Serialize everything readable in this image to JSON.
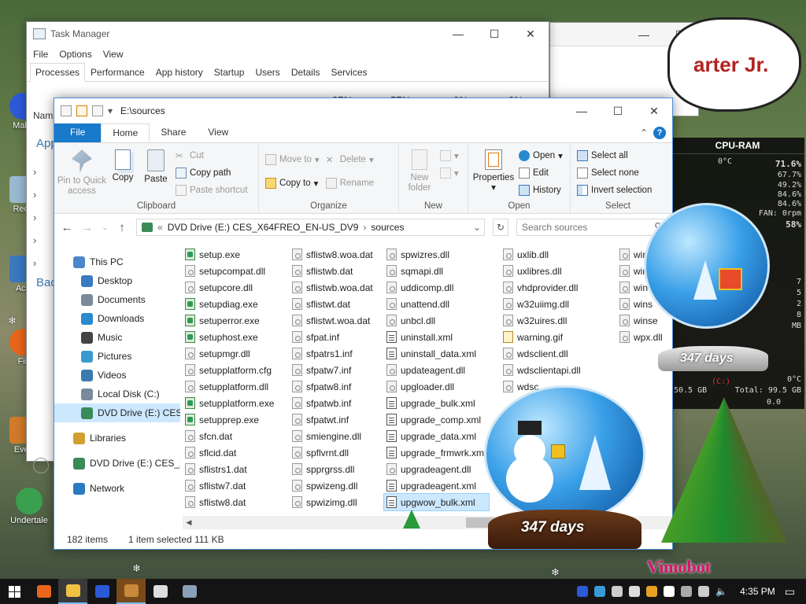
{
  "desktop": {
    "icons": [
      "Malw",
      "Recy",
      "Acti",
      "Fir",
      "Ever",
      "Undertale"
    ],
    "bubble_text": "arter Jr.",
    "watermark": "Vimobot"
  },
  "taskmgr": {
    "title": "Task Manager",
    "menu": [
      "File",
      "Options",
      "View"
    ],
    "tabs": [
      "Processes",
      "Performance",
      "App history",
      "Startup",
      "Users",
      "Details",
      "Services"
    ],
    "cols": [
      "87%",
      "57%",
      "0%",
      "0%"
    ],
    "left_labels": [
      "Nam",
      "App",
      "Bac"
    ]
  },
  "gadget": {
    "title": "CPU-RAM",
    "temp": "0°C",
    "values": [
      "71.6%",
      "67.7%",
      "49.2%",
      "84.6%",
      "84.6%",
      "FAN: 0rpm",
      "58%"
    ],
    "right_values": [
      "7",
      "5",
      "2",
      "8",
      "3",
      "MB",
      "2 MB"
    ],
    "drive_label": "(C:)",
    "drive_temp": "0°C",
    "used": "50.5 GB",
    "total": "Total: 99.5 GB",
    "zeros": [
      "0.0",
      "0.0"
    ]
  },
  "globes": {
    "small_days": "347 days",
    "large_days": "347 days"
  },
  "explorer": {
    "title_path": "E:\\sources",
    "tabs": {
      "file": "File",
      "home": "Home",
      "share": "Share",
      "view": "View"
    },
    "ribbon": {
      "clipboard": {
        "pin": "Pin to Quick access",
        "copy": "Copy",
        "paste": "Paste",
        "cut": "Cut",
        "copy_path": "Copy path",
        "paste_shortcut": "Paste shortcut",
        "name": "Clipboard"
      },
      "organize": {
        "move_to": "Move to",
        "copy_to": "Copy to",
        "delete": "Delete",
        "rename": "Rename",
        "name": "Organize"
      },
      "new": {
        "new_folder": "New folder",
        "name": "New"
      },
      "open": {
        "properties": "Properties",
        "open": "Open",
        "edit": "Edit",
        "history": "History",
        "name": "Open"
      },
      "select": {
        "select_all": "Select all",
        "select_none": "Select none",
        "invert": "Invert selection",
        "name": "Select"
      }
    },
    "address": {
      "prefix": "«",
      "crumbs": [
        "DVD Drive (E:) CES_X64FREO_EN-US_DV9",
        "sources"
      ],
      "search_placeholder": "Search sources"
    },
    "nav": [
      {
        "label": "This PC",
        "color": "#4a88c8"
      },
      {
        "label": "Desktop",
        "color": "#3a7ac0"
      },
      {
        "label": "Documents",
        "color": "#7a8a9a"
      },
      {
        "label": "Downloads",
        "color": "#2a8ad0"
      },
      {
        "label": "Music",
        "color": "#444444"
      },
      {
        "label": "Pictures",
        "color": "#3a9ad0"
      },
      {
        "label": "Videos",
        "color": "#3a7ab0"
      },
      {
        "label": "Local Disk (C:)",
        "color": "#7a8a9a"
      },
      {
        "label": "DVD Drive (E:) CES_X",
        "color": "#3a8a5a",
        "selected": true
      },
      {
        "label": "Libraries",
        "color": "#d0a030"
      },
      {
        "label": "DVD Drive (E:) CES_X6",
        "color": "#3a8a5a"
      },
      {
        "label": "Network",
        "color": "#2a7ac0"
      }
    ],
    "columns": [
      [
        {
          "name": "setup.exe",
          "type": "exe"
        },
        {
          "name": "setupcompat.dll",
          "type": "dll"
        },
        {
          "name": "setupcore.dll",
          "type": "dll"
        },
        {
          "name": "setupdiag.exe",
          "type": "exe"
        },
        {
          "name": "setuperror.exe",
          "type": "exe"
        },
        {
          "name": "setuphost.exe",
          "type": "exe"
        },
        {
          "name": "setupmgr.dll",
          "type": "dll"
        },
        {
          "name": "setupplatform.cfg",
          "type": "dll"
        },
        {
          "name": "setupplatform.dll",
          "type": "dll"
        },
        {
          "name": "setupplatform.exe",
          "type": "exe"
        },
        {
          "name": "setupprep.exe",
          "type": "exe"
        },
        {
          "name": "sfcn.dat",
          "type": "dll"
        },
        {
          "name": "sflcid.dat",
          "type": "dll"
        },
        {
          "name": "sflistrs1.dat",
          "type": "dll"
        },
        {
          "name": "sflistw7.dat",
          "type": "dll"
        },
        {
          "name": "sflistw8.dat",
          "type": "dll"
        }
      ],
      [
        {
          "name": "sflistw8.woa.dat",
          "type": "dll"
        },
        {
          "name": "sflistwb.dat",
          "type": "dll"
        },
        {
          "name": "sflistwb.woa.dat",
          "type": "dll"
        },
        {
          "name": "sflistwt.dat",
          "type": "dll"
        },
        {
          "name": "sflistwt.woa.dat",
          "type": "dll"
        },
        {
          "name": "sfpat.inf",
          "type": "dll"
        },
        {
          "name": "sfpatrs1.inf",
          "type": "dll"
        },
        {
          "name": "sfpatw7.inf",
          "type": "dll"
        },
        {
          "name": "sfpatw8.inf",
          "type": "dll"
        },
        {
          "name": "sfpatwb.inf",
          "type": "dll"
        },
        {
          "name": "sfpatwt.inf",
          "type": "dll"
        },
        {
          "name": "smiengine.dll",
          "type": "dll"
        },
        {
          "name": "spflvrnt.dll",
          "type": "dll"
        },
        {
          "name": "spprgrss.dll",
          "type": "dll"
        },
        {
          "name": "spwizeng.dll",
          "type": "dll"
        },
        {
          "name": "spwizimg.dll",
          "type": "dll"
        }
      ],
      [
        {
          "name": "spwizres.dll",
          "type": "dll"
        },
        {
          "name": "sqmapi.dll",
          "type": "dll"
        },
        {
          "name": "uddicomp.dll",
          "type": "dll"
        },
        {
          "name": "unattend.dll",
          "type": "dll"
        },
        {
          "name": "unbcl.dll",
          "type": "dll"
        },
        {
          "name": "uninstall.xml",
          "type": "xml"
        },
        {
          "name": "uninstall_data.xml",
          "type": "xml"
        },
        {
          "name": "updateagent.dll",
          "type": "dll"
        },
        {
          "name": "upgloader.dll",
          "type": "dll"
        },
        {
          "name": "upgrade_bulk.xml",
          "type": "xml"
        },
        {
          "name": "upgrade_comp.xml",
          "type": "xml"
        },
        {
          "name": "upgrade_data.xml",
          "type": "xml"
        },
        {
          "name": "upgrade_frmwrk.xml",
          "type": "xml"
        },
        {
          "name": "upgradeagent.dll",
          "type": "dll"
        },
        {
          "name": "upgradeagent.xml",
          "type": "xml"
        },
        {
          "name": "upgwow_bulk.xml",
          "type": "xml",
          "selected": true
        }
      ],
      [
        {
          "name": "uxlib.dll",
          "type": "dll"
        },
        {
          "name": "uxlibres.dll",
          "type": "dll"
        },
        {
          "name": "vhdprovider.dll",
          "type": "dll"
        },
        {
          "name": "w32uiimg.dll",
          "type": "dll"
        },
        {
          "name": "w32uires.dll",
          "type": "dll"
        },
        {
          "name": "warning.gif",
          "type": "gif"
        },
        {
          "name": "wdsclient.dll",
          "type": "dll"
        },
        {
          "name": "wdsclientapi.dll",
          "type": "dll"
        },
        {
          "name": "wdsc",
          "type": "dll"
        }
      ],
      [
        {
          "name": "win",
          "type": "dll"
        },
        {
          "name": "win",
          "type": "dll"
        },
        {
          "name": "win",
          "type": "dll"
        },
        {
          "name": "wins",
          "type": "dll"
        },
        {
          "name": "winse",
          "type": "dll"
        },
        {
          "name": "wpx.dll",
          "type": "dll"
        }
      ]
    ],
    "status": {
      "count": "182 items",
      "selection": "1 item selected  111 KB"
    }
  },
  "taskbar": {
    "apps": [
      {
        "name": "firefox",
        "color": "#e8651a"
      },
      {
        "name": "file-explorer",
        "color": "#f0c040",
        "active": true
      },
      {
        "name": "malwarebytes",
        "color": "#2a5ad8"
      },
      {
        "name": "app-4",
        "color": "#c88a3a",
        "running": true
      },
      {
        "name": "app-5",
        "color": "#dddddd"
      },
      {
        "name": "app-6",
        "color": "#8aa0b8"
      }
    ],
    "tray": [
      "#2a5ad8",
      "#3a9ad8",
      "#cccccc",
      "#dddddd",
      "#e8a020",
      "#ffffff",
      "#aaaaaa",
      "#cccccc"
    ],
    "time": "4:35 PM"
  }
}
